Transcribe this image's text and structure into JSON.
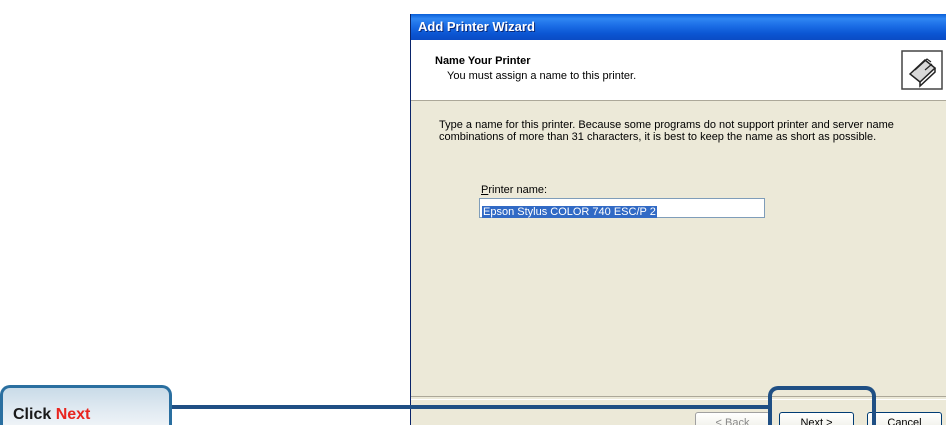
{
  "window": {
    "title": "Add Printer Wizard"
  },
  "header": {
    "title": "Name Your Printer",
    "subtitle": "You must assign a name to this printer.",
    "icon": "printer-wizard-icon"
  },
  "body": {
    "instructions": "Type a name for this printer. Because some programs do not support printer and server name combinations of more than 31 characters, it is best to keep the name as short as possible.",
    "field_label_accel": "P",
    "field_label_rest": "rinter name:",
    "printer_name": "Epson Stylus COLOR 740 ESC/P 2"
  },
  "buttons": {
    "back": "< Back",
    "next": "Next >",
    "cancel": "Cancel"
  },
  "callout": {
    "prefix": "Click",
    "highlight": "Next",
    "highlight_color": "#e8251f"
  },
  "colors": {
    "titlebar": "#0b56d3",
    "annotation_border": "#1f4f84",
    "selection": "#316ac5"
  }
}
